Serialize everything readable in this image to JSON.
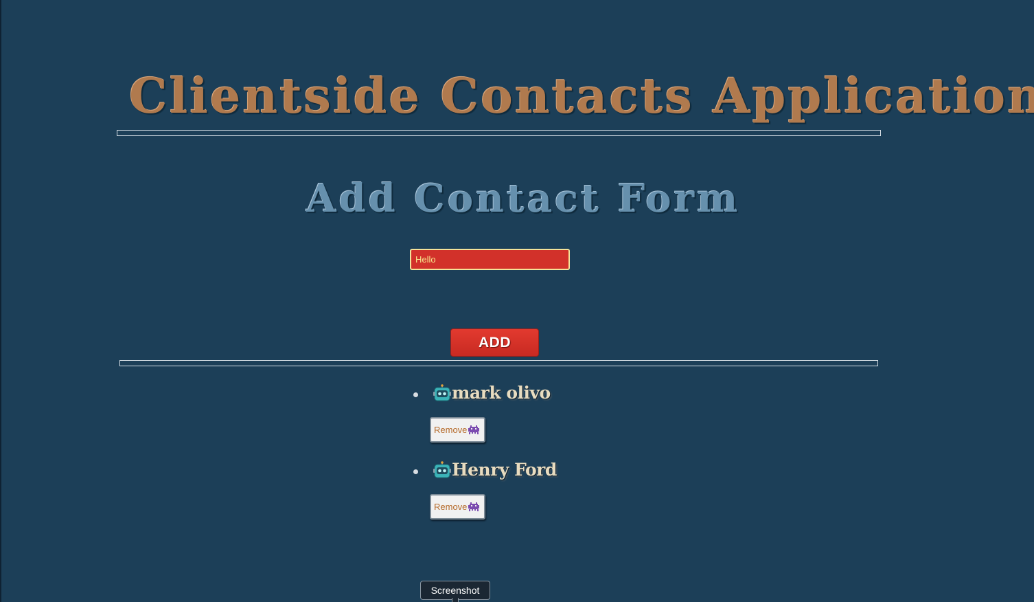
{
  "header": {
    "title": "Clientside Contacts Application"
  },
  "form": {
    "title": "Add Contact Form",
    "name_value": "Hello",
    "add_label": "ADD"
  },
  "contacts": [
    {
      "name": "mark olivo",
      "icon": "robot-icon",
      "remove_label": "Remove",
      "remove_icon": "alien-monster-icon"
    },
    {
      "name": "Henry Ford",
      "icon": "robot-icon",
      "remove_label": "Remove",
      "remove_icon": "alien-monster-icon"
    }
  ],
  "tooltip": {
    "label": "Screenshot"
  },
  "colors": {
    "background": "#1c3f58",
    "title": "#b07a4e",
    "form_title": "#6690ad",
    "input_bg": "#d2312a",
    "input_text": "#f6e58b",
    "add_button": "#d8332a",
    "contact_name": "#e8dcc0",
    "remove_text": "#b56a2a"
  }
}
